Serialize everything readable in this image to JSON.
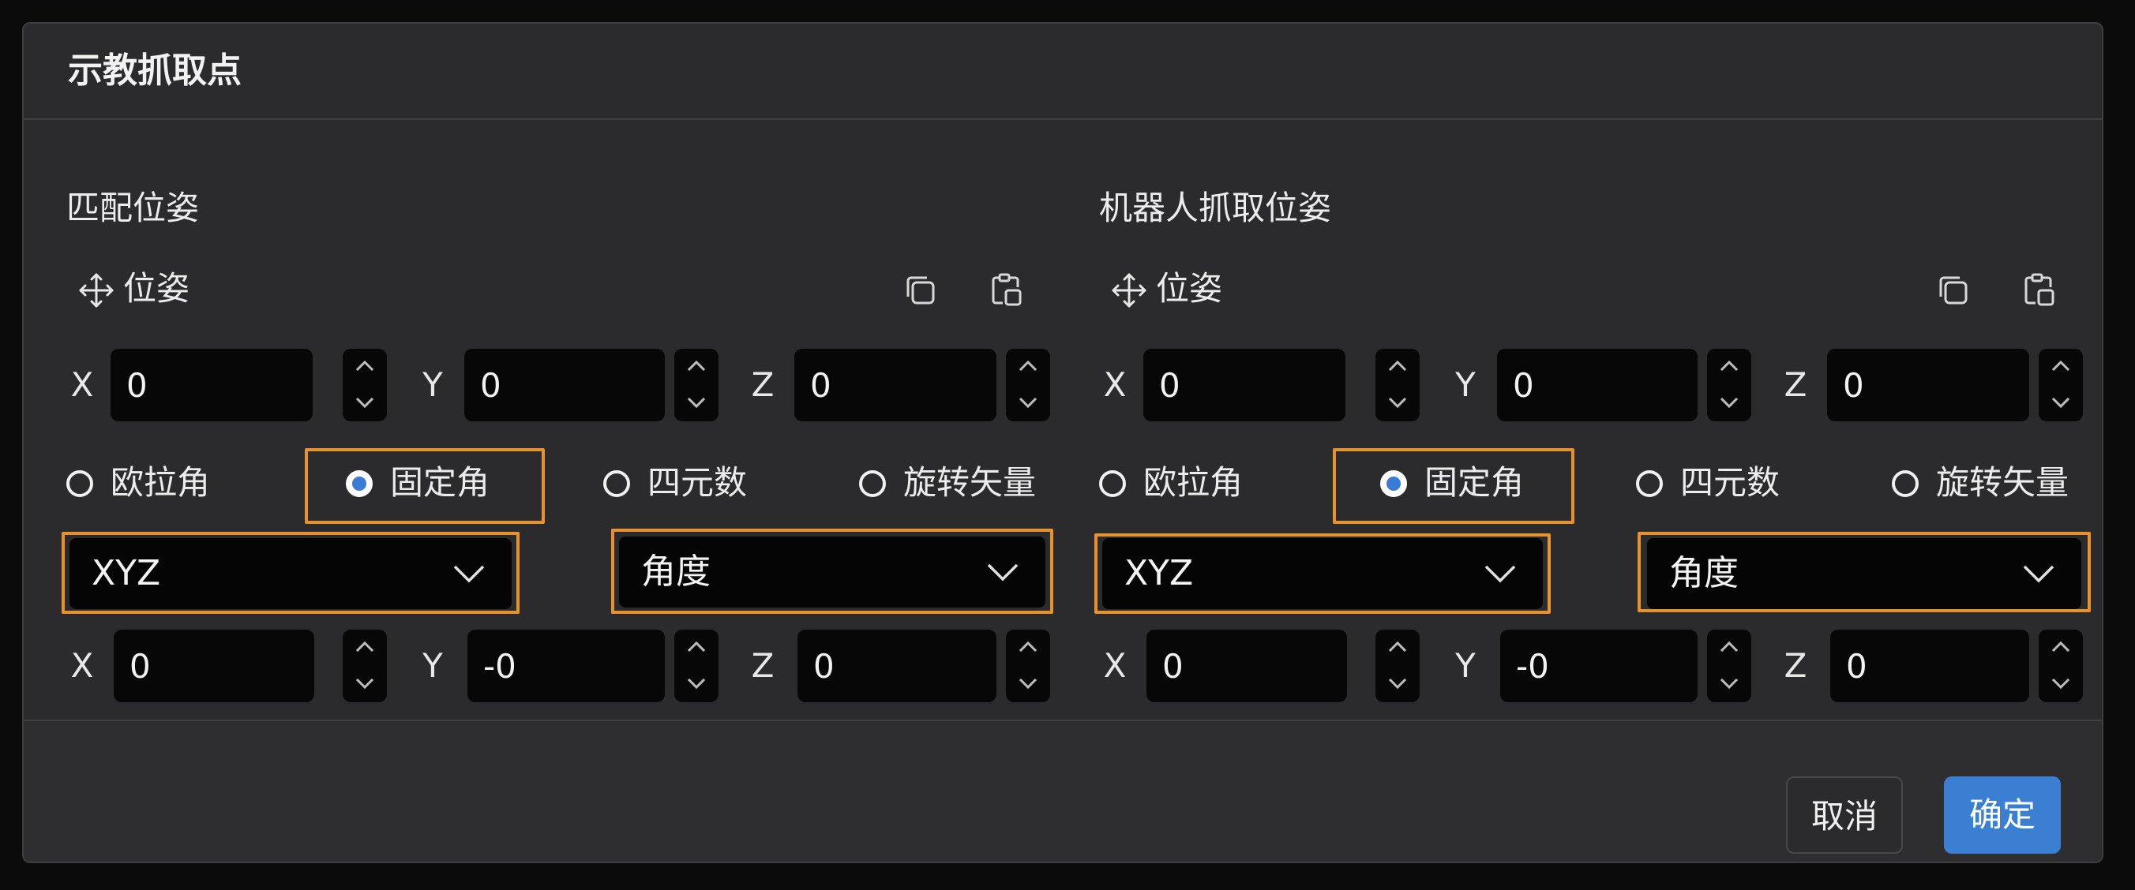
{
  "dialog": {
    "title": "示教抓取点"
  },
  "panels": [
    {
      "title": "匹配位姿",
      "pose_label": "位姿",
      "position": {
        "x": "0",
        "y": "0",
        "z": "0"
      },
      "rotation_modes": [
        "欧拉角",
        "固定角",
        "四元数",
        "旋转矢量"
      ],
      "selected_mode": "固定角",
      "order_select": "XYZ",
      "unit_select": "角度",
      "rotation": {
        "x": "0",
        "y": "-0",
        "z": "0"
      }
    },
    {
      "title": "机器人抓取位姿",
      "pose_label": "位姿",
      "position": {
        "x": "0",
        "y": "0",
        "z": "0"
      },
      "rotation_modes": [
        "欧拉角",
        "固定角",
        "四元数",
        "旋转矢量"
      ],
      "selected_mode": "固定角",
      "order_select": "XYZ",
      "unit_select": "角度",
      "rotation": {
        "x": "0",
        "y": "-0",
        "z": "0"
      }
    }
  ],
  "axis_labels": {
    "x": "X",
    "y": "Y",
    "z": "Z"
  },
  "footer": {
    "cancel_label": "取消",
    "confirm_label": "确定"
  },
  "colors": {
    "dialog_bg": "#2b2b2d",
    "input_bg": "#070707",
    "highlight": "#e8922d",
    "primary": "#3b7fd3"
  },
  "icons": {
    "pose": "move-arrows-icon",
    "copy": "copy-icon",
    "paste": "paste-icon",
    "stepper_up": "chevron-up-icon",
    "stepper_down": "chevron-down-icon",
    "select": "chevron-down-icon"
  }
}
